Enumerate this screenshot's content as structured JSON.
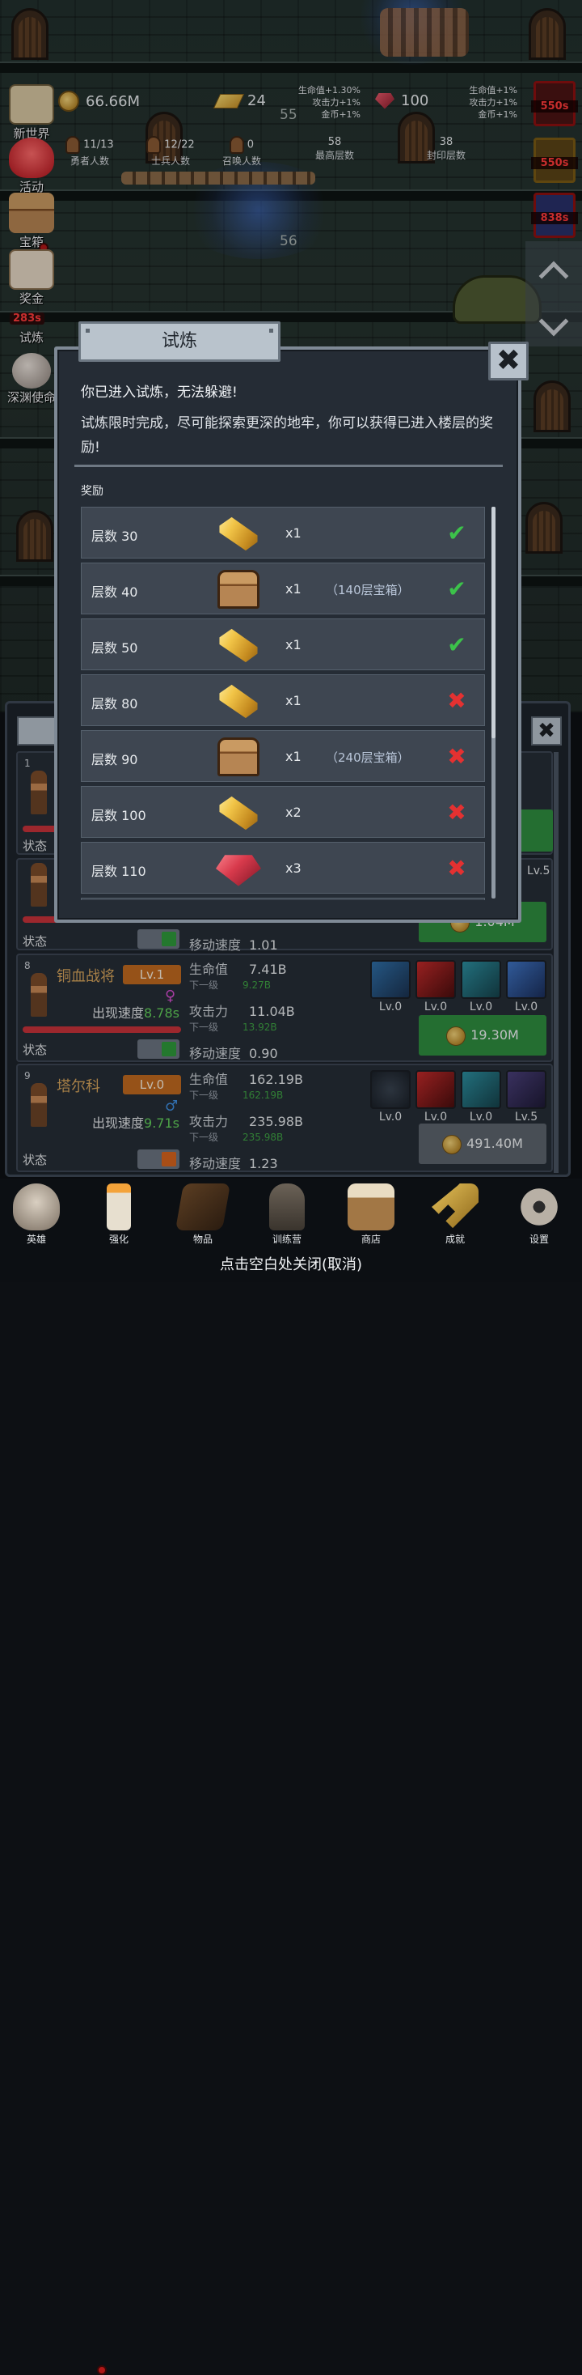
{
  "top_stats": {
    "gold": "66.66M",
    "gold_bars": "24",
    "gems": "100",
    "gold_bonus_lines": [
      "生命值+1.30%",
      "攻击力+1%",
      "金币+1%"
    ],
    "gem_bonus_lines": [
      "生命值+1%",
      "攻击力+1%",
      "金币+1%"
    ],
    "floor_upper": "55",
    "floor_lower": "56",
    "heroes": {
      "value": "11/13",
      "label": "勇者人数"
    },
    "soldiers": {
      "value": "12/22",
      "label": "士兵人数"
    },
    "summons": {
      "value": "0",
      "label": "召唤人数"
    },
    "max_floor": {
      "value": "58",
      "label": "最高层数"
    },
    "sealed_floor": {
      "value": "38",
      "label": "封印层数"
    }
  },
  "side_menu": [
    {
      "label": "新世界"
    },
    {
      "label": "活动"
    },
    {
      "label": "宝箱"
    },
    {
      "label": "奖金"
    },
    {
      "label": "试炼",
      "timer": "283s"
    },
    {
      "label": "深渊使命"
    }
  ],
  "boosts": [
    "550s",
    "550s",
    "838s"
  ],
  "modal": {
    "title": "试炼",
    "close": "✖",
    "line1": "你已进入试炼，无法躲避!",
    "desc": "试炼限时完成，尽可能探索更深的地牢，你可以获得已进入楼层的奖励!",
    "reward_header": "奖励",
    "rewards": [
      {
        "floor": "层数 30",
        "item": "gold-bar",
        "qty": "x1",
        "note": "",
        "done": true
      },
      {
        "floor": "层数 40",
        "item": "chest",
        "qty": "x1",
        "note": "（140层宝箱）",
        "done": true
      },
      {
        "floor": "层数 50",
        "item": "gold-bar",
        "qty": "x1",
        "note": "",
        "done": true
      },
      {
        "floor": "层数 80",
        "item": "gold-bar",
        "qty": "x1",
        "note": "",
        "done": false
      },
      {
        "floor": "层数 90",
        "item": "chest",
        "qty": "x1",
        "note": "（240层宝箱）",
        "done": false
      },
      {
        "floor": "层数 100",
        "item": "gold-bar",
        "qty": "x2",
        "note": "",
        "done": false
      },
      {
        "floor": "层数 110",
        "item": "ruby",
        "qty": "x3",
        "note": "",
        "done": false
      }
    ]
  },
  "heroes_panel": {
    "rows": [
      {
        "num": "1",
        "state": "状态"
      },
      {
        "state": "状态",
        "move_label": "移动速度",
        "move": "1.01",
        "cost": "1.04M"
      },
      {
        "num": "8",
        "name": "铜血战将",
        "lv": "Lv.1",
        "speed_label": "出现速度",
        "speed": "8.78s",
        "hp_label": "生命值",
        "hp": "7.41B",
        "next_label": "下一级",
        "hp_next": "9.27B",
        "atk_label": "攻击力",
        "atk": "11.04B",
        "atk_next": "13.92B",
        "state": "状态",
        "move_label": "移动速度",
        "move": "0.90",
        "skills": [
          "Lv.0",
          "Lv.0",
          "Lv.0",
          "Lv.0"
        ],
        "cost": "19.30M"
      },
      {
        "num": "9",
        "name": "塔尔科",
        "lv": "Lv.0",
        "speed_label": "出现速度",
        "speed": "9.71s",
        "hp_label": "生命值",
        "hp": "162.19B",
        "next_label": "下一级",
        "hp_next": "162.19B",
        "atk_label": "攻击力",
        "atk": "235.98B",
        "atk_next": "235.98B",
        "state": "状态",
        "move_label": "移动速度",
        "move": "1.23",
        "skills": [
          "Lv.0",
          "Lv.0",
          "Lv.0",
          "Lv.5"
        ],
        "cost": "491.40M"
      }
    ],
    "partial_lv": "Lv.5"
  },
  "bottom_nav": [
    "英雄",
    "强化",
    "物品",
    "训练营",
    "商店",
    "成就",
    "设置"
  ],
  "close_hint": "点击空白处关闭(取消)"
}
